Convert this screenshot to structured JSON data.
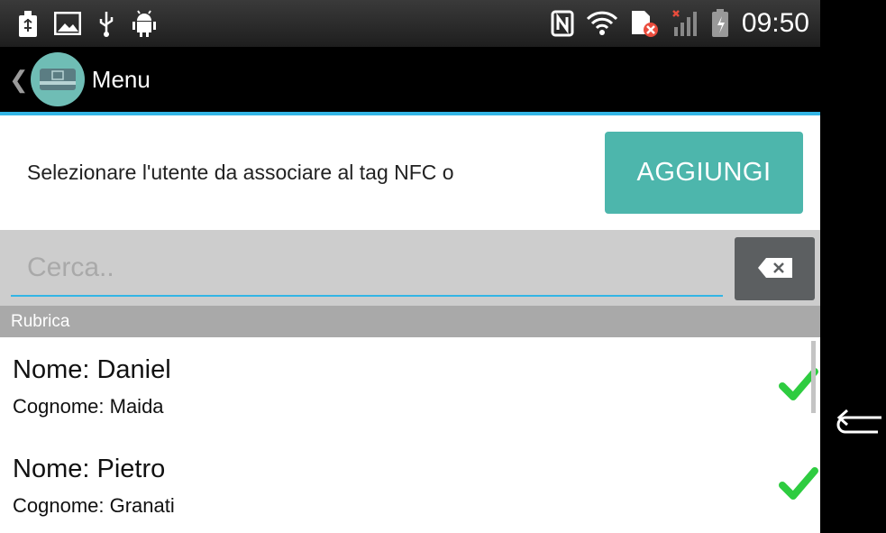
{
  "status_bar": {
    "time": "09:50",
    "left_icons": [
      "usb-icon",
      "image-icon",
      "usb-debug-icon",
      "android-icon"
    ],
    "right_icons": [
      "nfc-icon",
      "wifi-icon",
      "sim-error-icon",
      "signal-icon",
      "battery-icon"
    ]
  },
  "action_bar": {
    "title": "Menu"
  },
  "prompt": {
    "text": "Selezionare l'utente da associare al tag NFC o",
    "add_button": "AGGIUNGI"
  },
  "search": {
    "placeholder": "Cerca.."
  },
  "section": {
    "header": "Rubrica"
  },
  "contacts": [
    {
      "name": "Nome:  Daniel",
      "surname": "Cognome: Maida"
    },
    {
      "name": "Nome:  Pietro",
      "surname": "Cognome: Granati"
    }
  ],
  "colors": {
    "accent": "#33b5e5",
    "button": "#4db6ac",
    "check": "#2ecc40"
  }
}
